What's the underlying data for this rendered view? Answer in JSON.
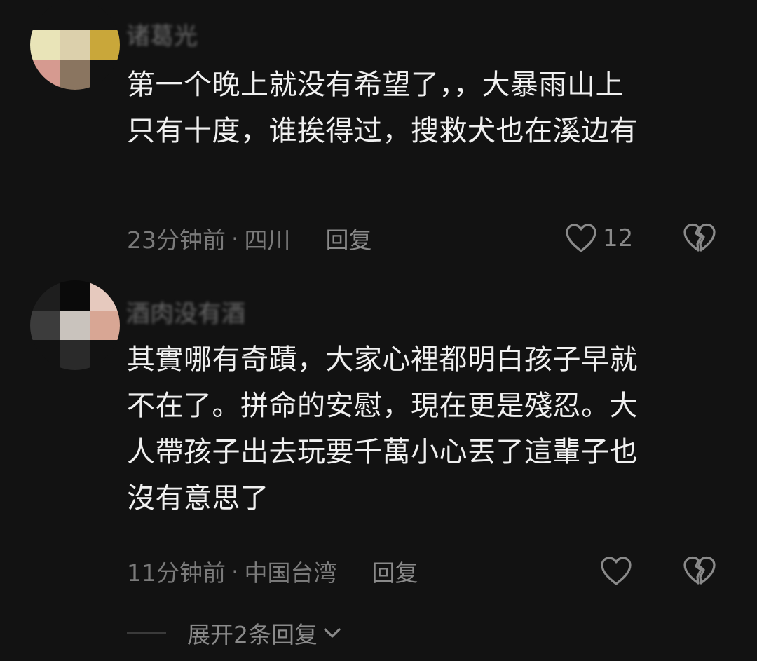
{
  "comments": [
    {
      "username": "诸葛光",
      "content_lines": [
        "第一个晚上就没有希望了，，大暴雨山上",
        "只有十度，谁挨得过，搜救犬也在溪边有"
      ],
      "time": "23分钟前",
      "separator": "·",
      "location": "四川",
      "reply_label": "回复",
      "like_count": "12",
      "avatar_colors": [
        "#121212",
        "#121212",
        "#121212",
        "#e9e4b8",
        "#dcd0ac",
        "#c9a73a",
        "#d69a90",
        "#8a7560",
        "#121212"
      ]
    },
    {
      "username": "酒肉没有酒",
      "content_lines": [
        "其實哪有奇蹟，大家心裡都明白孩子早就",
        "不在了。拼命的安慰，現在更是殘忍。大",
        "人帶孩子出去玩要千萬小心丟了這輩子也",
        "沒有意思了"
      ],
      "time": "11分钟前",
      "separator": "·",
      "location": "中国台湾",
      "reply_label": "回复",
      "like_count": "",
      "avatar_colors": [
        "#1e1e1e",
        "#0a0a0a",
        "#e6c9be",
        "#3c3c3c",
        "#c9c3bd",
        "#d8a694",
        "#121212",
        "#2a2a2a",
        "#121212"
      ]
    }
  ],
  "expand_replies_label": "展开2条回复"
}
